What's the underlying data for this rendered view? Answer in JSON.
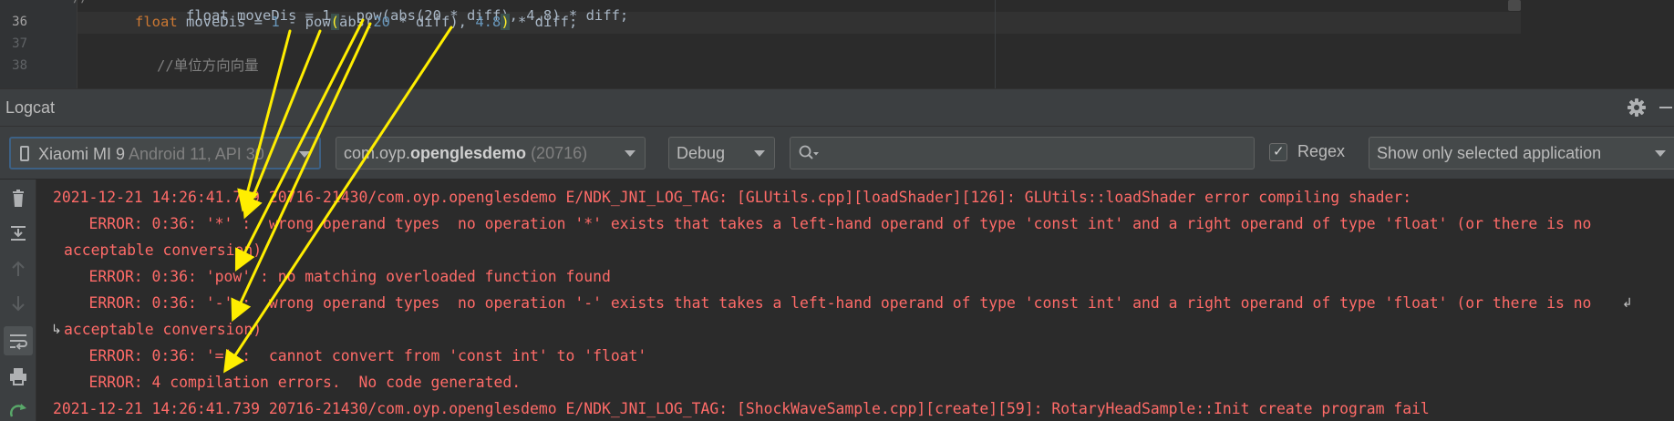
{
  "editor": {
    "line_numbers": [
      "36",
      "37",
      "38"
    ],
    "code_line_top_fragment": "float moveDis = 1 - pow(abs(20 * diff), 4.8) * diff;",
    "code_line_36": {
      "keyword": "float",
      "ident": " moveDis = ",
      "num1": "1",
      "mid1": " - pow",
      "paren_open": "(",
      "mid2": "abs(",
      "num2": "20",
      "mid3": " * diff), ",
      "num3": "4.8",
      "paren_close": ")",
      "tail": " * diff;"
    },
    "code_line_38": "//单位方向向量"
  },
  "logcat": {
    "title": "Logcat"
  },
  "toolbar": {
    "device": {
      "name": "Xiaomi MI 9",
      "detail": " Android 11, API 30"
    },
    "process": {
      "prefix": "com.oyp.",
      "bold": "openglesdemo",
      "pid": " (20716)"
    },
    "log_level": "Debug",
    "search": {
      "value": "",
      "placeholder": ""
    },
    "regex": {
      "label": "Regex",
      "checked": true
    },
    "filter": "Show only selected application"
  },
  "log_lines": [
    "2021-12-21 14:26:41.739 20716-21430/com.oyp.openglesdemo E/NDK_JNI_LOG_TAG: [GLUtils.cpp][loadShader][126]: GLUtils::loadShader error compiling shader:",
    "    ERROR: 0:36: '*' :  wrong operand types  no operation '*' exists that takes a left-hand operand of type 'const int' and a right operand of type 'float' (or there is no",
    "acceptable conversion)",
    "    ERROR: 0:36: 'pow' : no matching overloaded function found",
    "    ERROR: 0:36: '-' :  wrong operand types  no operation '-' exists that takes a left-hand operand of type 'const int' and a right operand of type 'float' (or there is no",
    "acceptable conversion)",
    "    ERROR: 0:36: '=' :  cannot convert from 'const int' to 'float'",
    "    ERROR: 4 compilation errors.  No code generated.",
    "2021-12-21 14:26:41.739 20716-21430/com.oyp.openglesdemo E/NDK_JNI_LOG_TAG: [ShockWaveSample.cpp][create][59]: RotaryHeadSample::Init create program fail"
  ],
  "colors": {
    "error_text": "#ff6b68",
    "annotation_arrow": "#ffee00",
    "background": "#2b2b2b",
    "toolbar": "#3c3f41"
  },
  "icons": {
    "header": [
      "gear-icon",
      "minimize-icon"
    ],
    "side": [
      "trash-icon",
      "scroll-to-end-icon",
      "up-arrow-icon",
      "down-arrow-icon",
      "soft-wrap-icon",
      "print-icon",
      "restart-icon"
    ]
  }
}
